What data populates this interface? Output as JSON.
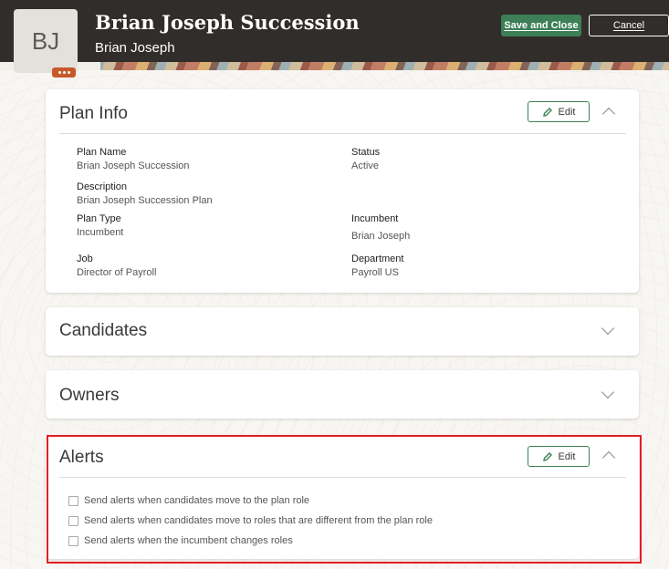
{
  "header": {
    "avatar_initials": "BJ",
    "title": "Brian Joseph Succession",
    "subtitle": "Brian Joseph",
    "save_label": "Save and Close",
    "cancel_label": "Cancel",
    "colors": {
      "bar": "#312d2a",
      "accent": "#3d7f56",
      "avatar_badge": "#c75a2a"
    }
  },
  "plan_info": {
    "title": "Plan Info",
    "edit_label": "Edit",
    "fields": {
      "plan_name": {
        "label": "Plan Name",
        "value": "Brian Joseph Succession"
      },
      "status": {
        "label": "Status",
        "value": "Active"
      },
      "description": {
        "label": "Description",
        "value": "Brian Joseph Succession Plan"
      },
      "plan_type": {
        "label": "Plan Type",
        "value": "Incumbent"
      },
      "incumbent": {
        "label": "Incumbent",
        "value": "Brian Joseph"
      },
      "job": {
        "label": "Job",
        "value": "Director of Payroll"
      },
      "department": {
        "label": "Department",
        "value": "Payroll US"
      }
    }
  },
  "candidates": {
    "title": "Candidates"
  },
  "owners": {
    "title": "Owners"
  },
  "alerts": {
    "title": "Alerts",
    "edit_label": "Edit",
    "items": [
      {
        "label": "Send alerts when candidates move to the plan role",
        "checked": false
      },
      {
        "label": "Send alerts when candidates move to roles that are different from the plan role",
        "checked": false
      },
      {
        "label": "Send alerts when the incumbent changes roles",
        "checked": false
      }
    ],
    "highlight_color": "#e01f26"
  }
}
